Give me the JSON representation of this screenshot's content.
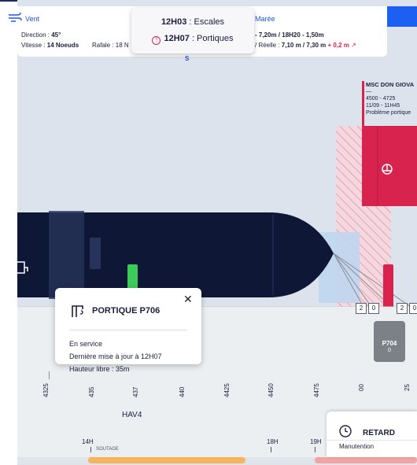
{
  "weather": {
    "wind_label": "Vent",
    "direction_label": "Direction : ",
    "direction_value": "45°",
    "speed_label": "Vitesse : ",
    "speed_value": "14 Noeuds",
    "gust_label": "Rafale : 18 N"
  },
  "tide": {
    "label": "Marée",
    "line1": "- 7,20m / 18H20 - 1,50m",
    "line2_prefix": "/ Réelle : ",
    "line2_value": "7,10 m / 7,30 m",
    "line2_delta": "+ 0,2 m"
  },
  "dropdown": {
    "row1_time": "12H03",
    "row1_label": " : Escales",
    "row2_time": "12H07",
    "row2_label": " : Portiques",
    "warn_glyph": "!",
    "sub_letter": "S"
  },
  "ship": {
    "name": "MSC DON GIOVA",
    "dash": "—",
    "range": "4500 - 4725",
    "datetime": "11/09 - 11H45",
    "issue": "Problème portique"
  },
  "berth_boxes": [
    "2",
    "0",
    "2",
    "0"
  ],
  "crane_p704": {
    "label": "P704",
    "value": "0"
  },
  "ruler": {
    "ticks": [
      "4325",
      "435",
      "437",
      "440",
      "4425",
      "4450",
      "4475",
      "00",
      "25"
    ],
    "zone": "HAV4",
    "hours": [
      "14H",
      "18H",
      "19H"
    ],
    "soutage": "SOUTAGE"
  },
  "popup": {
    "title": "PORTIQUE P706",
    "close": "✕",
    "status": "En service",
    "updated": "Dernière mise à jour à 12H07",
    "clearance": "Hauteur libre : 35m"
  },
  "retard": {
    "title": "RETARD",
    "subtitle": "Manutention"
  },
  "colors": {
    "hull": "#0f1736",
    "alert": "#d8234f",
    "accent": "#1d5ff0",
    "crane_ok": "#3ccb5b",
    "slot_orange": "#f6b45f"
  }
}
